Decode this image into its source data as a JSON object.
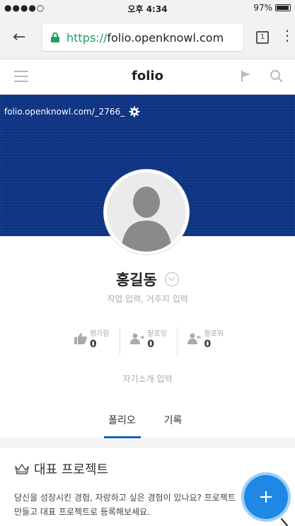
{
  "status_bar": {
    "signal": "●●●●○ ",
    "time": "오후 4:34",
    "battery_text": "97%"
  },
  "browser": {
    "url_scheme": "https://",
    "url_host": "folio.openknowl.com",
    "tab_count": "1"
  },
  "app_header": {
    "title": "folio"
  },
  "banner": {
    "profile_url": "folio.openknowl.com/_2766_"
  },
  "profile": {
    "name": "홍길동",
    "sub_info": "직업 입력, 거주지 입력",
    "bio_placeholder": "자기소개 입력",
    "stats": [
      {
        "label": "평가함",
        "count": "0"
      },
      {
        "label": "팔로잉",
        "count": "0"
      },
      {
        "label": "팔로워",
        "count": "0"
      }
    ]
  },
  "tabs": [
    {
      "label": "폴리오",
      "active": true
    },
    {
      "label": "기록",
      "active": false
    }
  ],
  "section": {
    "title": "대표 프로젝트",
    "desc_line1": "당신을 성장시킨 경험, 자랑하고 싶은 경험이 있나요? 프로젝트",
    "desc_line2": "만들고 대표 프로젝트로 등록해보세요."
  },
  "fab": {
    "label": "+"
  },
  "colors": {
    "banner": "#0c3282",
    "accent": "#1565c0",
    "fab": "#1f88e5",
    "lock": "#1aa260"
  }
}
